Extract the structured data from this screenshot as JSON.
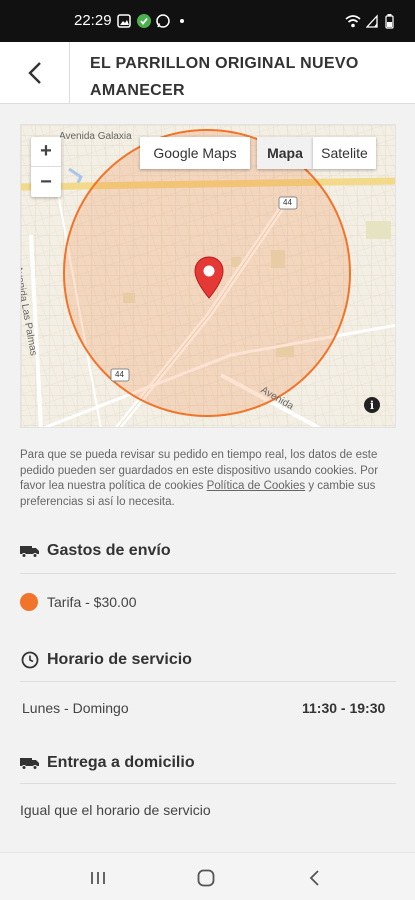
{
  "status_bar": {
    "time": "22:29"
  },
  "header": {
    "title": "EL PARRILLON ORIGINAL NUEVO AMANECER"
  },
  "map": {
    "zoom_in": "+",
    "zoom_out": "−",
    "google_maps_label": "Google Maps",
    "mapa_label": "Mapa",
    "satelite_label": "Satelite",
    "info_label": "i",
    "street_labels": [
      "Avenida Galaxia",
      "Avenida Las Palmas",
      "44",
      "44",
      "Avenida"
    ]
  },
  "notice": {
    "text_1": "Para que se pueda revisar su pedido en tiempo real, los datos de este pedido pueden ser guardados en este dispositivo usando cookies. Por favor lea nuestra política de cookies ",
    "link": "Política de Cookies",
    "text_2": " y cambie sus preferencias si así lo necesita."
  },
  "shipping": {
    "title": "Gastos de envío",
    "fee": "Tarifa - $30.00"
  },
  "hours": {
    "title": "Horario de servicio",
    "days": "Lunes - Domingo",
    "time": "11:30 - 19:30"
  },
  "delivery": {
    "title": "Entrega a domicilio",
    "text": "Igual que el horario de servicio"
  },
  "colors": {
    "accent": "#f0742a",
    "pin": "#e53935",
    "status_bg": "#111111"
  }
}
